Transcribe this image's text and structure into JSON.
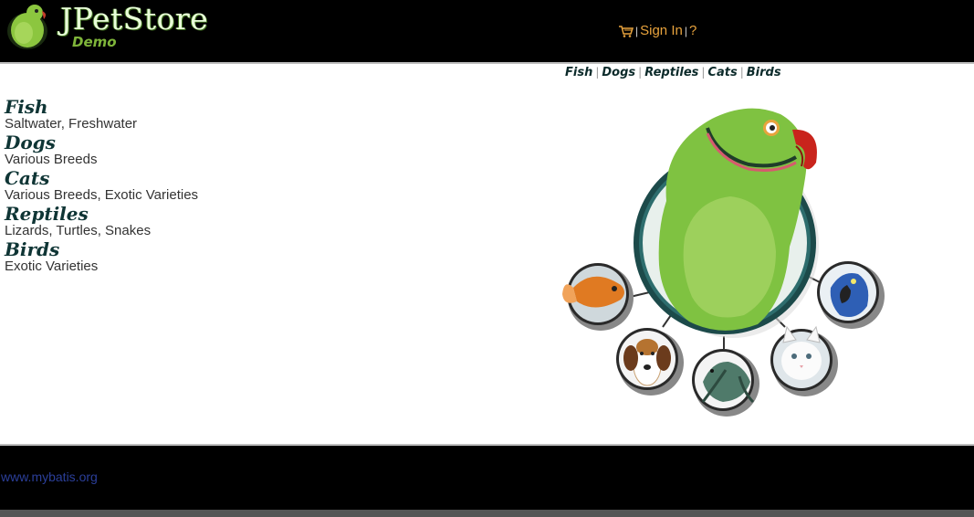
{
  "logo": {
    "title": "JPetStore",
    "subtitle": "Demo"
  },
  "menu": {
    "cart_icon": "shopping-cart-icon",
    "sign_in": "Sign In",
    "help": "?"
  },
  "quicklinks": [
    "Fish",
    "Dogs",
    "Reptiles",
    "Cats",
    "Birds"
  ],
  "sidebar": {
    "categories": [
      {
        "title": "Fish",
        "desc": "Saltwater, Freshwater"
      },
      {
        "title": "Dogs",
        "desc": "Various Breeds"
      },
      {
        "title": "Cats",
        "desc": "Various Breeds, Exotic Varieties"
      },
      {
        "title": "Reptiles",
        "desc": "Lizards, Turtles, Snakes"
      },
      {
        "title": "Birds",
        "desc": "Exotic Varieties"
      }
    ]
  },
  "footer": {
    "link": "www.mybatis.org"
  },
  "colors": {
    "header_bg": "#000000",
    "menu_link": "#e8a33d",
    "category_title": "#0f3535",
    "footer_link": "#2b3f9a"
  }
}
